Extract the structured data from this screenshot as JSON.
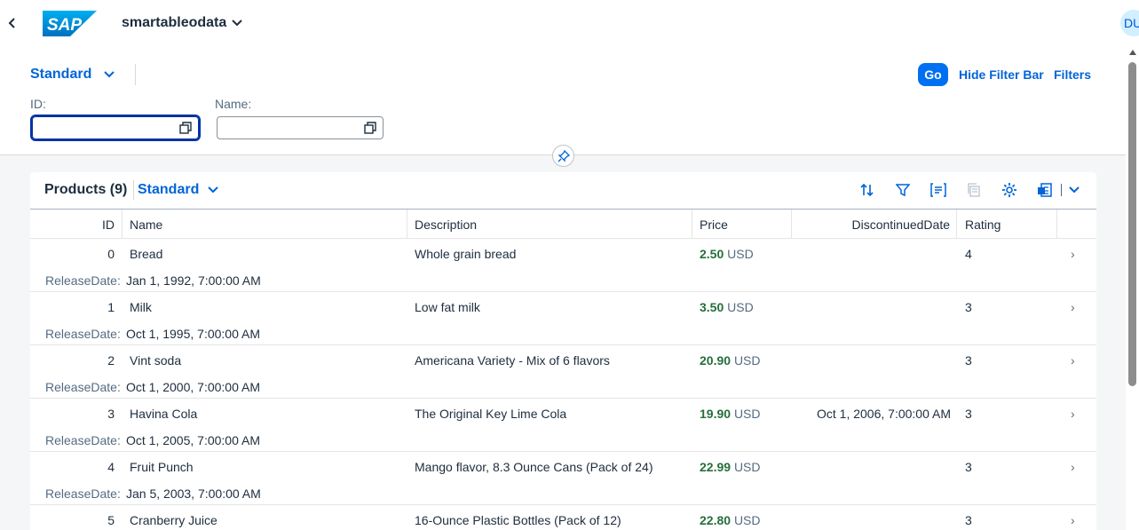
{
  "shell": {
    "app_title": "smartableodata",
    "avatar_initials": "DU",
    "logo_text": "SAP"
  },
  "filter_bar": {
    "variant": "Standard",
    "go_label": "Go",
    "hide_label": "Hide Filter Bar",
    "filters_label": "Filters",
    "fields": [
      {
        "label": "ID:",
        "value": ""
      },
      {
        "label": "Name:",
        "value": ""
      }
    ]
  },
  "table": {
    "title": "Products (9)",
    "variant": "Standard",
    "columns": [
      "ID",
      "Name",
      "Description",
      "Price",
      "DiscontinuedDate",
      "Rating"
    ],
    "popin_label": "ReleaseDate:",
    "rows": [
      {
        "id": "0",
        "name": "Bread",
        "description": "Whole grain bread",
        "price": "2.50",
        "currency": "USD",
        "discontinued": "",
        "rating": "4",
        "release_date": "Jan 1, 1992, 7:00:00 AM"
      },
      {
        "id": "1",
        "name": "Milk",
        "description": "Low fat milk",
        "price": "3.50",
        "currency": "USD",
        "discontinued": "",
        "rating": "3",
        "release_date": "Oct 1, 1995, 7:00:00 AM"
      },
      {
        "id": "2",
        "name": "Vint soda",
        "description": "Americana Variety - Mix of 6 flavors",
        "price": "20.90",
        "currency": "USD",
        "discontinued": "",
        "rating": "3",
        "release_date": "Oct 1, 2000, 7:00:00 AM"
      },
      {
        "id": "3",
        "name": "Havina Cola",
        "description": "The Original Key Lime Cola",
        "price": "19.90",
        "currency": "USD",
        "discontinued": "Oct 1, 2006, 7:00:00 AM",
        "rating": "3",
        "release_date": "Oct 1, 2005, 7:00:00 AM"
      },
      {
        "id": "4",
        "name": "Fruit Punch",
        "description": "Mango flavor, 8.3 Ounce Cans (Pack of 24)",
        "price": "22.99",
        "currency": "USD",
        "discontinued": "",
        "rating": "3",
        "release_date": "Jan 5, 2003, 7:00:00 AM"
      },
      {
        "id": "5",
        "name": "Cranberry Juice",
        "description": "16-Ounce Plastic Bottles (Pack of 12)",
        "price": "22.80",
        "currency": "USD",
        "discontinued": "",
        "rating": "3",
        "release_date": ""
      }
    ]
  },
  "colors": {
    "brand": "#0070f2",
    "link": "#0064d9",
    "price_positive": "#256f3a",
    "text": "#1d2d3e",
    "muted": "#556b82"
  },
  "icons": {
    "toolbar": [
      "sort-icon",
      "filter-icon",
      "group-icon",
      "copy-icon",
      "settings-icon",
      "export-icon",
      "chevron-down-icon"
    ]
  }
}
